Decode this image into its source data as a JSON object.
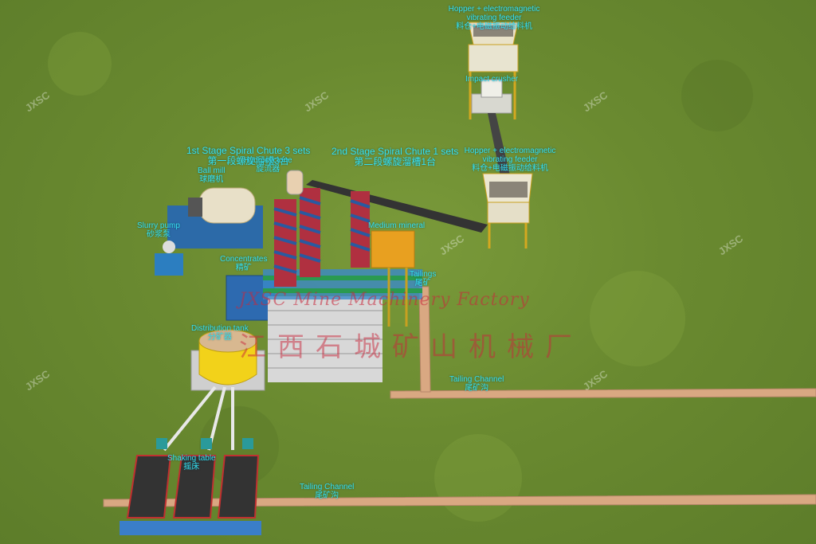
{
  "labels": {
    "hopper_top_en": "Hopper + electromagnetic vibrating feeder",
    "hopper_top_cn": "料仓+电磁振动给料机",
    "impact_crusher": "Impact crusher",
    "hopper2_en": "Hopper + electromagnetic vibrating feeder",
    "hopper2_cn": "料仓+电磁振动给料机",
    "stage1_en": "1st Stage Spiral Chute 3 sets",
    "stage1_cn": "第一段螺旋溜槽3台",
    "hydrocyclone_en": "Hydrocyclone",
    "hydrocyclone_cn": "旋流器",
    "stage2_en": "2nd Stage Spiral Chute 1 sets",
    "stage2_cn": "第二段螺旋溜槽1台",
    "ball_mill_en": "Ball mill",
    "ball_mill_cn": "球磨机",
    "slurry_pump_en": "Slurry pump",
    "slurry_pump_cn": "砂浆泵",
    "medium_mineral": "Medium mineral",
    "concentrates_en": "Concentrates",
    "concentrates_cn": "精矿",
    "tailings_en": "Tailings",
    "tailings_cn": "尾矿",
    "distribution_en": "Distribution tank",
    "distribution_cn": "分矿器",
    "tailing_channel1_en": "Tailing Channel",
    "tailing_channel1_cn": "尾矿沟",
    "shaking_table_en": "Shaking table",
    "shaking_table_cn": "摇床",
    "tailing_channel2_en": "Tailing Channel",
    "tailing_channel2_cn": "尾矿沟"
  },
  "watermark": {
    "en": "JXSC Mine Machinery Factory",
    "cn": "江西石城矿山机械厂",
    "tile": "JXSC"
  },
  "colors": {
    "label": "#35e0f0",
    "grass": "#6a8a30",
    "watermark": "#c8283c"
  }
}
